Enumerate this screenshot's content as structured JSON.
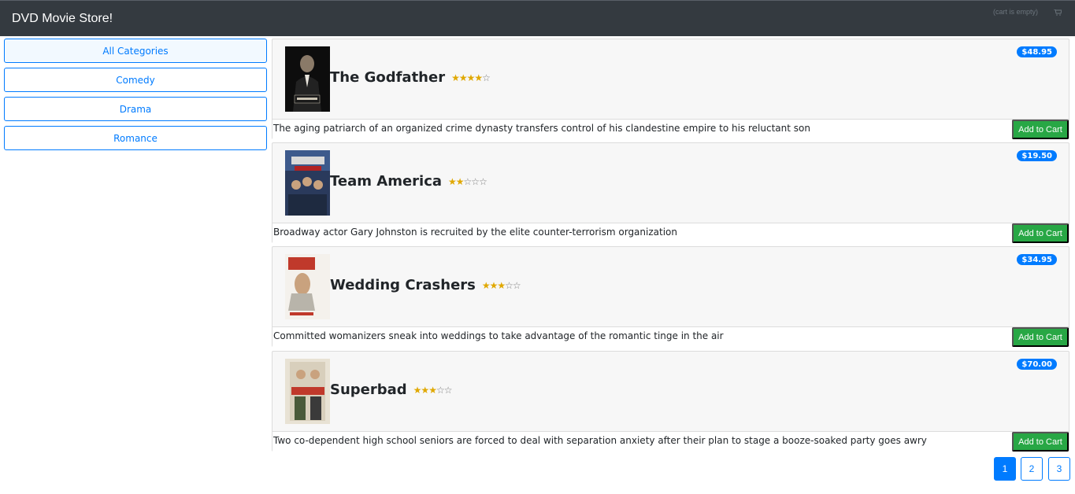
{
  "app": {
    "brand": "DVD Movie Store!",
    "cart_status": "(cart is empty)",
    "cart_icon": "cart-icon"
  },
  "categories": [
    {
      "label": "All Categories",
      "active": true
    },
    {
      "label": "Comedy",
      "active": false
    },
    {
      "label": "Drama",
      "active": false
    },
    {
      "label": "Romance",
      "active": false
    }
  ],
  "products": [
    {
      "title": "The Godfather",
      "rating": 4,
      "max_rating": 5,
      "price": "$48.95",
      "description": "The aging patriarch of an organized crime dynasty transfers control of his clandestine empire to his reluctant son",
      "button": "Add to Cart"
    },
    {
      "title": "Team America",
      "rating": 2,
      "max_rating": 5,
      "price": "$19.50",
      "description": "Broadway actor Gary Johnston is recruited by the elite counter-terrorism organization",
      "button": "Add to Cart"
    },
    {
      "title": "Wedding Crashers",
      "rating": 3,
      "max_rating": 5,
      "price": "$34.95",
      "description": "Committed womanizers sneak into weddings to take advantage of the romantic tinge in the air",
      "button": "Add to Cart"
    },
    {
      "title": "Superbad",
      "rating": 3,
      "max_rating": 5,
      "price": "$70.00",
      "description": "Two co-dependent high school seniors are forced to deal with separation anxiety after their plan to stage a booze-soaked party goes awry",
      "button": "Add to Cart"
    }
  ],
  "pagination": {
    "pages": [
      "1",
      "2",
      "3"
    ],
    "current": "1"
  },
  "colors": {
    "navbar": "#343a40",
    "primary": "#007bff",
    "success": "#28a745",
    "star": "#e0a800"
  }
}
